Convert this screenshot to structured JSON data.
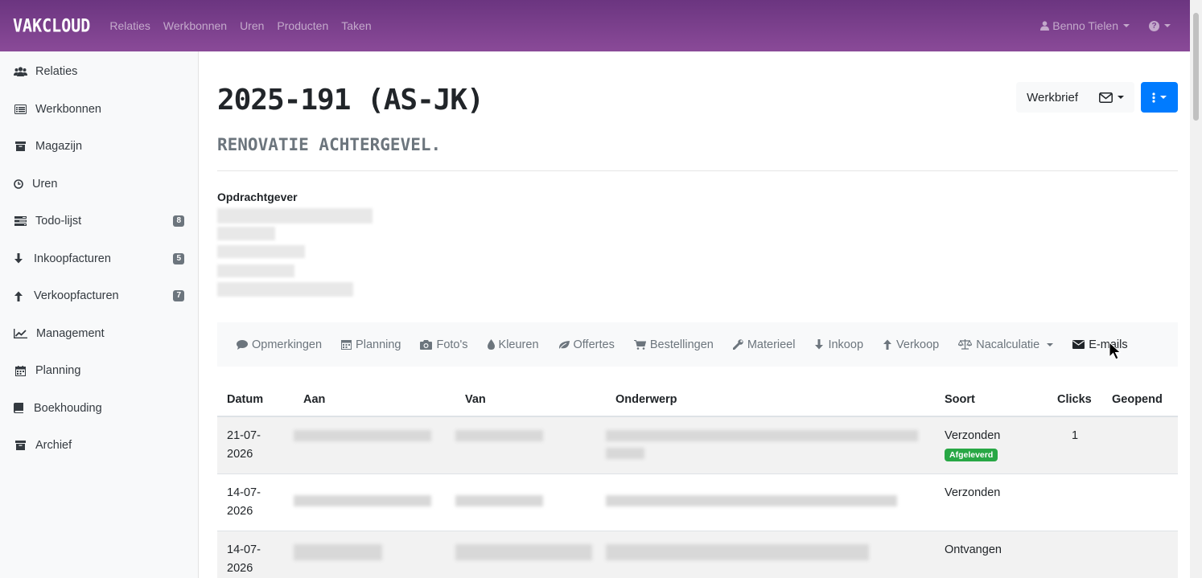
{
  "navbar": {
    "brand": "VAKCLOUD",
    "links": [
      "Relaties",
      "Werkbonnen",
      "Uren",
      "Producten",
      "Taken"
    ],
    "user": "Benno Tielen"
  },
  "sidebar": {
    "items": [
      {
        "label": "Relaties",
        "icon": "users-icon"
      },
      {
        "label": "Werkbonnen",
        "icon": "list-alt-icon"
      },
      {
        "label": "Magazijn",
        "icon": "archive-icon"
      },
      {
        "label": "Uren",
        "icon": "clock-icon"
      },
      {
        "label": "Todo-lijst",
        "icon": "tasks-icon",
        "badge": "8"
      },
      {
        "label": "Inkoopfacturen",
        "icon": "arrow-down-icon",
        "badge": "5"
      },
      {
        "label": "Verkoopfacturen",
        "icon": "arrow-up-icon",
        "badge": "7"
      },
      {
        "label": "Management",
        "icon": "line-chart-icon"
      },
      {
        "label": "Planning",
        "icon": "calendar-icon"
      },
      {
        "label": "Boekhouding",
        "icon": "book-icon"
      },
      {
        "label": "Archief",
        "icon": "archive-icon"
      }
    ]
  },
  "page": {
    "title": "2025-191 (AS-JK)",
    "subtitle": "RENOVATIE ACHTERGEVEL.",
    "werkbrief_label": "Werkbrief",
    "client_label": "Opdrachtgever"
  },
  "tabs": [
    {
      "label": "Opmerkingen",
      "icon": "comment-icon"
    },
    {
      "label": "Planning",
      "icon": "calendar-icon"
    },
    {
      "label": "Foto's",
      "icon": "camera-icon"
    },
    {
      "label": "Kleuren",
      "icon": "tint-icon"
    },
    {
      "label": "Offertes",
      "icon": "leaf-icon"
    },
    {
      "label": "Bestellingen",
      "icon": "cart-icon"
    },
    {
      "label": "Materieel",
      "icon": "wrench-icon"
    },
    {
      "label": "Inkoop",
      "icon": "arrow-down-icon"
    },
    {
      "label": "Verkoop",
      "icon": "arrow-up-icon"
    },
    {
      "label": "Nacalculatie",
      "icon": "balance-icon"
    },
    {
      "label": "E-mails",
      "icon": "envelope-icon",
      "active": true
    }
  ],
  "table": {
    "headers": [
      "Datum",
      "Aan",
      "Van",
      "Onderwerp",
      "Soort",
      "Clicks",
      "Geopend"
    ],
    "rows": [
      {
        "datum": "21-07-2026",
        "soort": "Verzonden",
        "badge": "Afgeleverd",
        "clicks": "1",
        "geopend": ""
      },
      {
        "datum": "14-07-2026",
        "soort": "Verzonden",
        "badge": "",
        "clicks": "",
        "geopend": ""
      },
      {
        "datum": "14-07-2026",
        "soort": "Ontvangen",
        "badge": "",
        "clicks": "",
        "geopend": ""
      }
    ]
  },
  "colors": {
    "navbar": "#7a4190",
    "primary": "#007bff",
    "success": "#28a745",
    "badge": "#6c757d"
  }
}
